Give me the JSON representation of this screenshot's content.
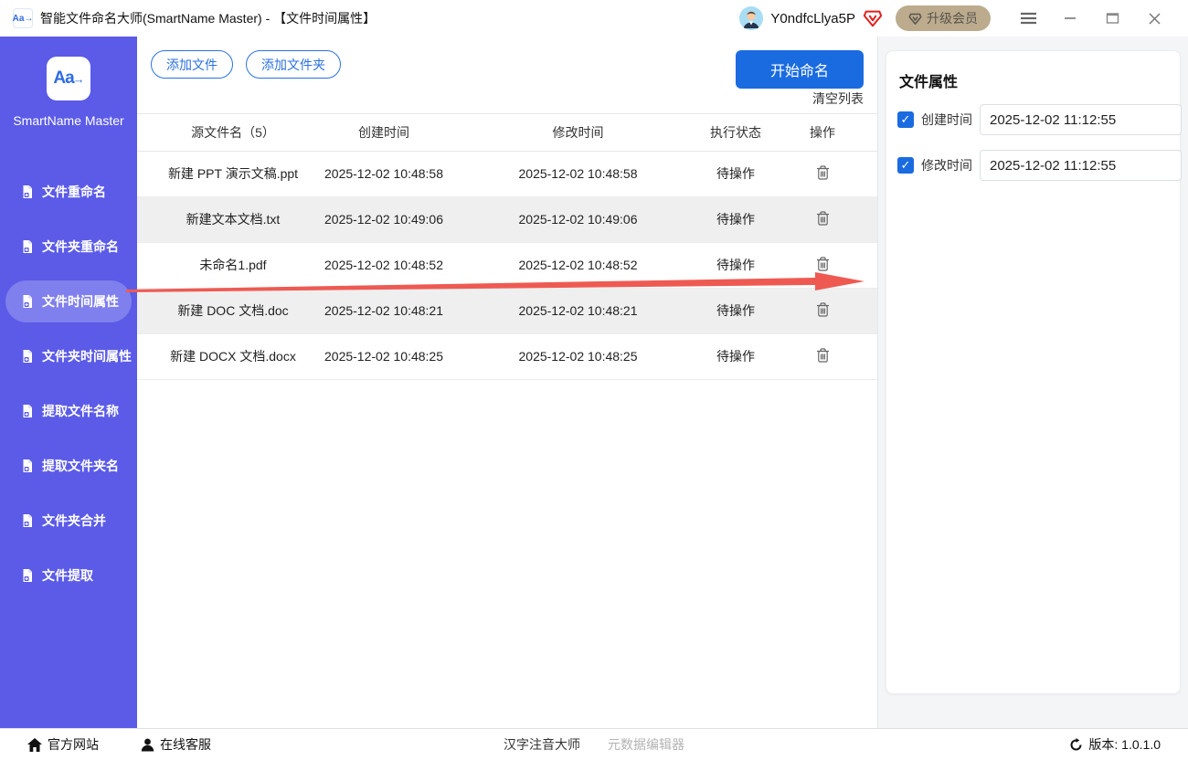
{
  "title_bar": {
    "app_title": "智能文件命名大师(SmartName Master) - 【文件时间属性】",
    "username": "Y0ndfcLlya5P",
    "upgrade_label": "升级会员"
  },
  "sidebar": {
    "brand": "SmartName Master",
    "items": [
      {
        "label": "文件重命名",
        "active": false
      },
      {
        "label": "文件夹重命名",
        "active": false
      },
      {
        "label": "文件时间属性",
        "active": true
      },
      {
        "label": "文件夹时间属性",
        "active": false
      },
      {
        "label": "提取文件名称",
        "active": false
      },
      {
        "label": "提取文件夹名",
        "active": false
      },
      {
        "label": "文件夹合并",
        "active": false
      },
      {
        "label": "文件提取",
        "active": false
      }
    ]
  },
  "toolbar": {
    "add_files": "添加文件",
    "add_folder": "添加文件夹",
    "start_naming": "开始命名",
    "clear_list": "清空列表"
  },
  "table": {
    "headers": [
      "源文件名（5）",
      "创建时间",
      "修改时间",
      "执行状态",
      "操作"
    ],
    "rows": [
      {
        "name": "新建 PPT 演示文稿.ppt",
        "created": "2025-12-02 10:48:58",
        "modified": "2025-12-02 10:48:58",
        "status": "待操作"
      },
      {
        "name": "新建文本文档.txt",
        "created": "2025-12-02 10:49:06",
        "modified": "2025-12-02 10:49:06",
        "status": "待操作"
      },
      {
        "name": "未命名1.pdf",
        "created": "2025-12-02 10:48:52",
        "modified": "2025-12-02 10:48:52",
        "status": "待操作"
      },
      {
        "name": "新建 DOC 文档.doc",
        "created": "2025-12-02 10:48:21",
        "modified": "2025-12-02 10:48:21",
        "status": "待操作"
      },
      {
        "name": "新建 DOCX 文档.docx",
        "created": "2025-12-02 10:48:25",
        "modified": "2025-12-02 10:48:25",
        "status": "待操作"
      }
    ]
  },
  "panel": {
    "title": "文件属性",
    "fields": [
      {
        "label": "创建时间",
        "value": "2025-12-02 11:12:55",
        "checked": true
      },
      {
        "label": "修改时间",
        "value": "2025-12-02 11:12:55",
        "checked": true
      }
    ]
  },
  "footer": {
    "website": "官方网站",
    "support": "在线客服",
    "center_links": [
      {
        "label": "汉字注音大师",
        "muted": false
      },
      {
        "label": "元数据编辑器",
        "muted": true
      }
    ],
    "version": "版本: 1.0.1.0"
  },
  "colors": {
    "sidebar_purple": "#5b5be8",
    "primary_blue": "#1a6be0",
    "arrow_red": "#ee5a52",
    "upgrade_tan": "#bcab8d",
    "vip_red": "#e02020",
    "alt_row_gray": "#efefef"
  }
}
